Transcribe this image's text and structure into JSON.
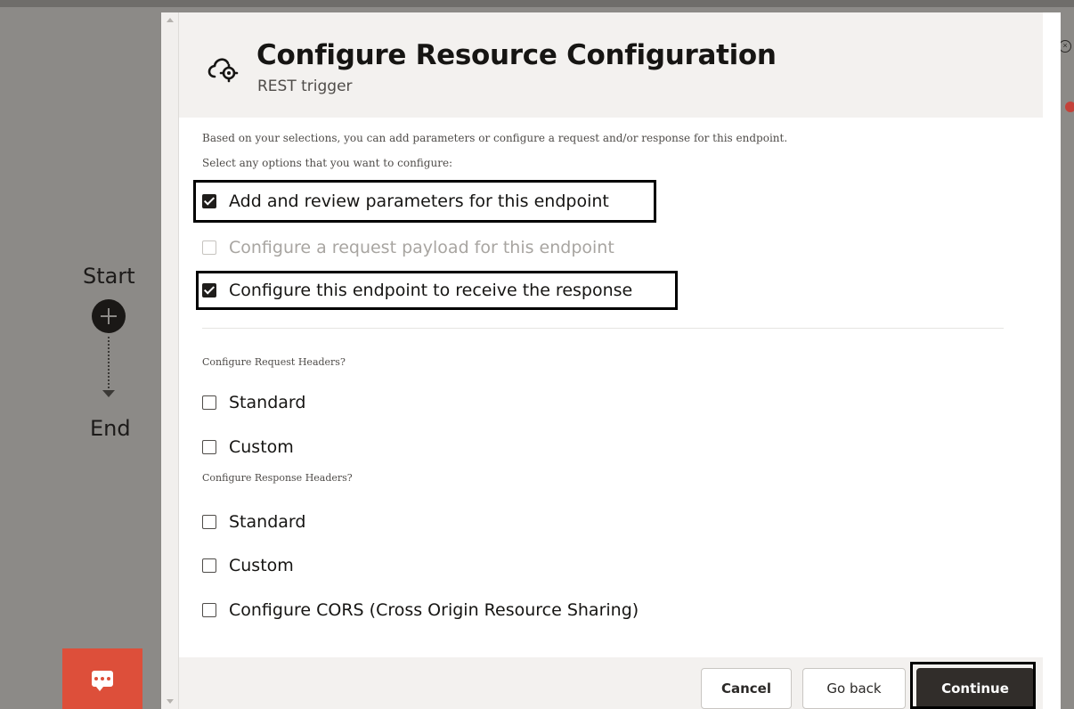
{
  "canvas": {
    "start_label": "Start",
    "end_label": "End"
  },
  "dialog": {
    "title": "Configure Resource Configuration",
    "subtitle": "REST trigger",
    "icon": "cloud-gear-icon",
    "intro_text_1": "Based on your selections, you can add parameters or configure a request and/or response for this endpoint.",
    "intro_text_2": "Select any options that you want to configure:",
    "options": [
      {
        "label": "Add and review parameters for this endpoint",
        "checked": true,
        "disabled": false
      },
      {
        "label": "Configure a request payload for this endpoint",
        "checked": false,
        "disabled": true
      },
      {
        "label": "Configure this endpoint to receive the response",
        "checked": true,
        "disabled": false
      }
    ],
    "request_headers": {
      "label": "Configure Request Headers?",
      "options": [
        {
          "label": "Standard",
          "checked": false
        },
        {
          "label": "Custom",
          "checked": false
        }
      ]
    },
    "response_headers": {
      "label": "Configure Response Headers?",
      "options": [
        {
          "label": "Standard",
          "checked": false
        },
        {
          "label": "Custom",
          "checked": false
        }
      ]
    },
    "cors": {
      "label": "Configure CORS (Cross Origin Resource Sharing)",
      "checked": false
    }
  },
  "footer": {
    "cancel_label": "Cancel",
    "goback_label": "Go back",
    "continue_label": "Continue"
  },
  "colors": {
    "primary_button": "#312d2a",
    "chat_button": "#dd4f3a",
    "header_bg": "#f3f1ef"
  }
}
